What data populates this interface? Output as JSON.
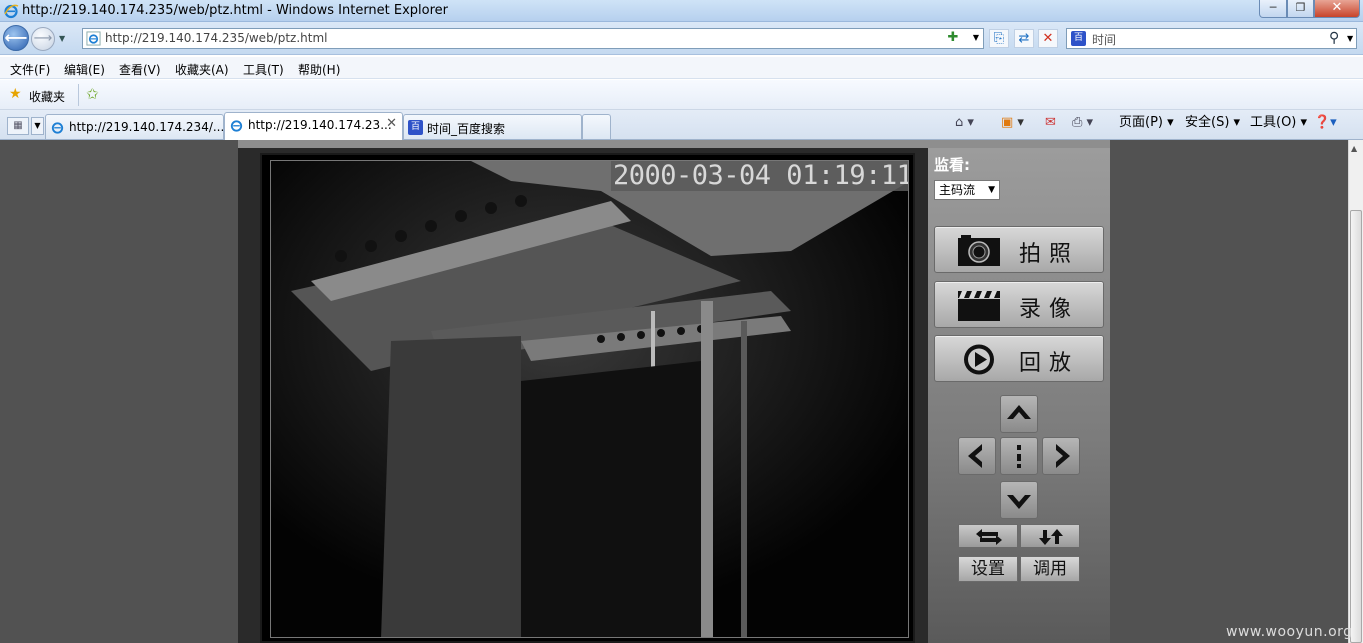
{
  "window": {
    "title": "http://219.140.174.235/web/ptz.html - Windows Internet Explorer",
    "min_label": "─",
    "max_label": "❐",
    "close_label": "✕"
  },
  "address": {
    "url": "http://219.140.174.235/web/ptz.html"
  },
  "search": {
    "text": "时间"
  },
  "menu": {
    "items": [
      {
        "label": "文件(F)"
      },
      {
        "label": "编辑(E)"
      },
      {
        "label": "查看(V)"
      },
      {
        "label": "收藏夹(A)"
      },
      {
        "label": "工具(T)"
      },
      {
        "label": "帮助(H)"
      }
    ]
  },
  "favorites": {
    "label": "收藏夹"
  },
  "tabs": [
    {
      "label": "http://219.140.174.234/...",
      "active": false
    },
    {
      "label": "http://219.140.174.23...",
      "active": true
    },
    {
      "label": "时间_百度搜索",
      "active": false
    }
  ],
  "command_bar": {
    "page": "页面(P)",
    "safety": "安全(S)",
    "tools": "工具(O)"
  },
  "camera": {
    "timestamp": "2000-03-04 01:19:11"
  },
  "panel": {
    "monitor_label": "监看:",
    "stream_selected": "主码流",
    "snapshot_label": "拍照",
    "record_label": "录像",
    "playback_label": "回放",
    "set_label": "设置",
    "call_label": "调用"
  },
  "watermark": "www.wooyun.org",
  "colors": {
    "page_bg": "#525252",
    "panel_bg": "#8e8e8e",
    "ie_chrome": "#c4d9f0"
  }
}
